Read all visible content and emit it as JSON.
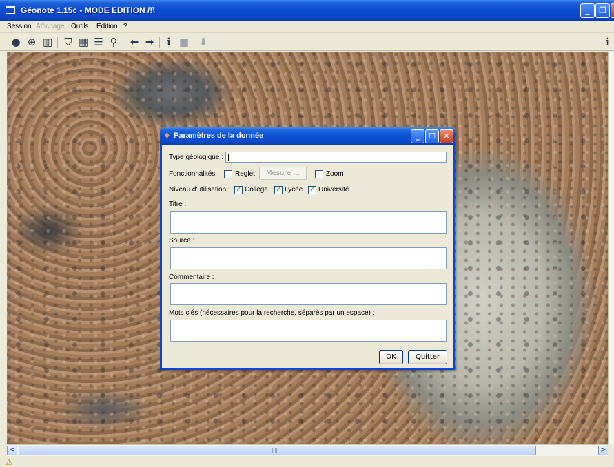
{
  "window": {
    "title": "Géonote 1.15c  -  MODE EDITION  /!\\",
    "min_glyph": "_",
    "max_glyph": "❐",
    "close_glyph": "✕"
  },
  "menu": {
    "session": "Session",
    "affichage": "Affichage",
    "outils": "Outils",
    "edition": "Edition",
    "help": "?"
  },
  "toolbar": {
    "icons": [
      "globe-icon",
      "crosshair-globe-icon",
      "panel-icon",
      "shield-icon",
      "grid-icon",
      "list-icon",
      "magnifier-icon",
      "arrow-left-icon",
      "arrow-right-icon",
      "info-icon",
      "image-icon",
      "down-arrow-icon"
    ],
    "right_glyph": "i"
  },
  "dialog": {
    "title": "Paramètres de la donnée",
    "type_label": "Type géologique :",
    "type_value": "",
    "fonction_label": "Fonctionnalités :",
    "reglet_label": "Reglet",
    "reglet_checked": false,
    "mesure_label": "Mesure ...",
    "zoom_label": "Zoom",
    "zoom_checked": false,
    "niveau_label": "Niveau d'utilisation :",
    "college_label": "Collège",
    "college_checked": true,
    "lycee_label": "Lycée",
    "lycee_checked": true,
    "universite_label": "Université",
    "universite_checked": true,
    "titre_label": "Titre :",
    "titre_value": "",
    "source_label": "Source :",
    "source_value": "",
    "commentaire_label": "Commentaire :",
    "commentaire_value": "",
    "mots_label": "Mots clés (nécessaires pour la recherche, séparés par un espace) :",
    "mots_value": "",
    "ok_label": "OK",
    "quitter_label": "Quitter"
  },
  "scroll": {
    "left": "<",
    "right": ">",
    "grip": "|||"
  },
  "status": {
    "warning_icon": "⚠"
  }
}
